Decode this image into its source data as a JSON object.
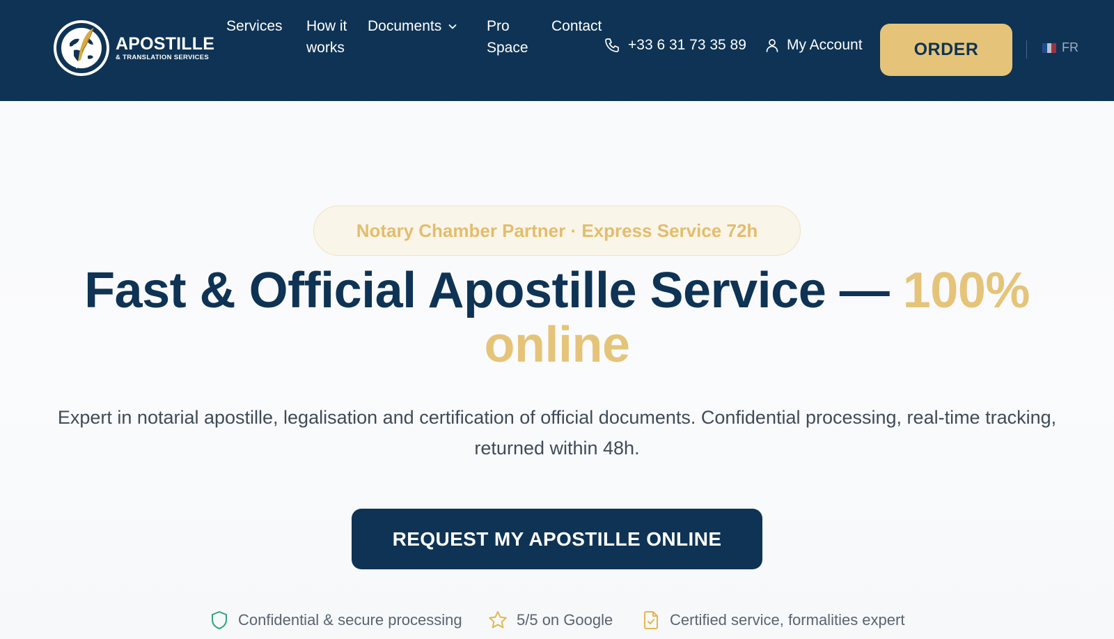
{
  "header": {
    "logo": {
      "title": "APOSTILLE",
      "subtitle": "& TRANSLATION SERVICES"
    },
    "nav": [
      {
        "label": "Services"
      },
      {
        "label": "How it works"
      },
      {
        "label": "Documents",
        "has_dropdown": true
      },
      {
        "label": "Pro Space"
      },
      {
        "label": "Contact"
      }
    ],
    "phone": "+33 6 31 73 35 89",
    "account_label": "My Account",
    "order_label": "ORDER",
    "language": "FR"
  },
  "hero": {
    "badge": "Notary Chamber Partner · Express Service 72h",
    "headline_main": "Fast & Official Apostille Service — ",
    "headline_accent": "100% online",
    "subtitle": "Expert in notarial apostille, legalisation and certification of official documents. Confidential processing, real-time tracking, returned within 48h.",
    "cta_label": "REQUEST MY APOSTILLE ONLINE"
  },
  "trust": [
    {
      "icon": "shield-icon",
      "label": "Confidential & secure processing"
    },
    {
      "icon": "star-icon",
      "label": "5/5 on Google"
    },
    {
      "icon": "document-check-icon",
      "label": "Certified service, formalities expert"
    }
  ],
  "colors": {
    "navy": "#0e3354",
    "gold": "#e5c479",
    "shield_green": "#2fa37a",
    "text_gray": "#3f4b58"
  }
}
